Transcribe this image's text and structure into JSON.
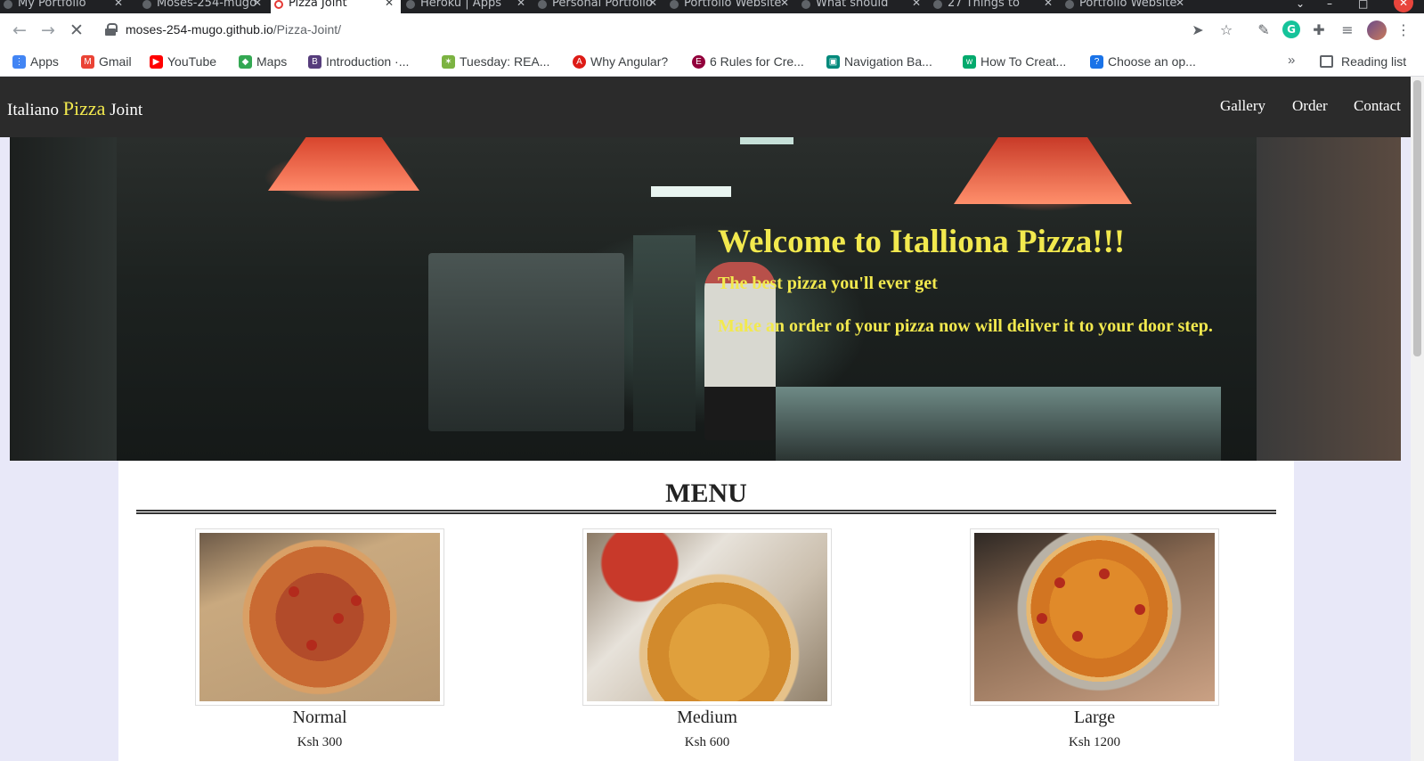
{
  "browser": {
    "tabs": [
      {
        "label": "My Portfolio",
        "active": false
      },
      {
        "label": "Moses-254-mugo",
        "active": false
      },
      {
        "label": "Pizza Joint",
        "active": true
      },
      {
        "label": "Heroku | Apps",
        "active": false
      },
      {
        "label": "Personal Portfolio",
        "active": false
      },
      {
        "label": "Portfolio Website",
        "active": false
      },
      {
        "label": "What should",
        "active": false
      },
      {
        "label": "27 Things to",
        "active": false
      },
      {
        "label": "Portfolio Website",
        "active": false
      }
    ],
    "url_host": "moses-254-mugo.github.io",
    "url_path": "/Pizza-Joint/",
    "bookmarks": [
      {
        "label": "Apps",
        "icon": "apps-grid-icon",
        "color": "#4285f4"
      },
      {
        "label": "Gmail",
        "icon": "gmail-icon",
        "color": "#ea4335"
      },
      {
        "label": "YouTube",
        "icon": "youtube-icon",
        "color": "#ff0000"
      },
      {
        "label": "Maps",
        "icon": "maps-icon",
        "color": "#34a853"
      },
      {
        "label": "Introduction ·...",
        "icon": "bootstrap-icon",
        "color": "#563d7c"
      },
      {
        "label": "Tuesday: REA...",
        "icon": "palm-icon",
        "color": "#7cb342"
      },
      {
        "label": "Why Angular?",
        "icon": "angular-icon",
        "color": "#dd1b16"
      },
      {
        "label": "6 Rules for Cre...",
        "icon": "elementor-icon",
        "color": "#92003b"
      },
      {
        "label": "Navigation Ba...",
        "icon": "bookmark-green-icon",
        "color": "#00897b"
      },
      {
        "label": "How To Creat...",
        "icon": "w3schools-icon",
        "color": "#04aa6d"
      },
      {
        "label": "Choose an op...",
        "icon": "question-icon",
        "color": "#1a73e8"
      }
    ],
    "reading_list": "Reading list",
    "more_bookmarks": "»"
  },
  "site": {
    "brand_prefix": "Italiano",
    "brand_accent": "Pizza",
    "brand_suffix": "Joint",
    "nav": [
      "Gallery",
      "Order",
      "Contact"
    ],
    "accent_color": "#f2e94e"
  },
  "hero": {
    "title": "Welcome to Italliona Pizza!!!",
    "subtitle": "The best pizza you'll ever get",
    "tagline": "Make an order of your pizza now will deliver it to your door step."
  },
  "menu": {
    "title": "MENU",
    "items": [
      {
        "size": "Normal",
        "price": "Ksh 300"
      },
      {
        "size": "Medium",
        "price": "Ksh 600"
      },
      {
        "size": "Large",
        "price": "Ksh 1200"
      }
    ]
  }
}
